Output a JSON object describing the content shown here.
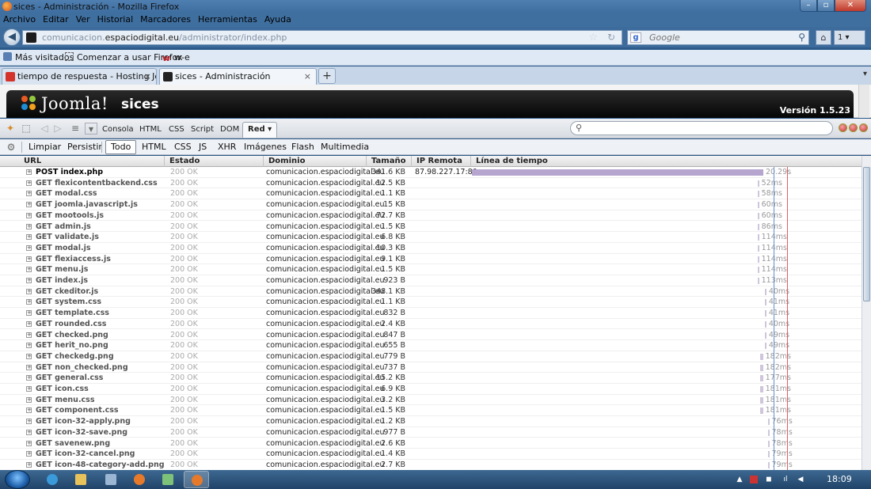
{
  "window": {
    "title": "sices - Administración - Mozilla Firefox"
  },
  "menu": [
    "Archivo",
    "Editar",
    "Ver",
    "Historial",
    "Marcadores",
    "Herramientas",
    "Ayuda"
  ],
  "nav": {
    "url_prefix": "comunicacion.",
    "url_domain": "espaciodigital.eu",
    "url_path": "/administrator/index.php",
    "search_placeholder": "Google",
    "ext_badge": "1"
  },
  "bookmarks": [
    "Más visitados",
    "Comenzar a usar Firefox",
    "w-e"
  ],
  "tabs": [
    {
      "label": "tiempo de respuesta - Hosting Joomla"
    },
    {
      "label": "sices - Administración"
    }
  ],
  "joomla": {
    "brand": "Joomla!",
    "site": "sices",
    "version": "Versión 1.5.23"
  },
  "firebug": {
    "panels": [
      "Consola",
      "HTML",
      "CSS",
      "Script",
      "DOM",
      "Red"
    ],
    "selected_panel": "Red",
    "filters": [
      "Limpiar",
      "Persistir",
      "Todo",
      "HTML",
      "CSS",
      "JS",
      "XHR",
      "Imágenes",
      "Flash",
      "Multimedia"
    ],
    "selected_filter": "Todo"
  },
  "net": {
    "columns": {
      "url": "URL",
      "status": "Estado",
      "domain": "Dominio",
      "size": "Tamaño",
      "ip": "IP Remota",
      "timeline": "Línea de tiempo"
    },
    "rows": [
      {
        "url": "POST index.php",
        "status": "200 OK",
        "domain": "comunicacion.espaciodigital.eu",
        "size": "341.6 KB",
        "ip": "87.98.227.17:80",
        "time": "20.29s",
        "start": 0.0,
        "dur": 1.0
      },
      {
        "url": "GET flexicontentbackend.css",
        "status": "200 OK",
        "domain": "comunicacion.espaciodigital.eu",
        "size": "12.5 KB",
        "ip": "",
        "time": "52ms",
        "start": 0.98,
        "dur": 0.003
      },
      {
        "url": "GET modal.css",
        "status": "200 OK",
        "domain": "comunicacion.espaciodigital.eu",
        "size": "1.1 KB",
        "ip": "",
        "time": "58ms",
        "start": 0.98,
        "dur": 0.003
      },
      {
        "url": "GET joomla.javascript.js",
        "status": "200 OK",
        "domain": "comunicacion.espaciodigital.eu",
        "size": "15 KB",
        "ip": "",
        "time": "60ms",
        "start": 0.98,
        "dur": 0.003
      },
      {
        "url": "GET mootools.js",
        "status": "200 OK",
        "domain": "comunicacion.espaciodigital.eu",
        "size": "72.7 KB",
        "ip": "",
        "time": "60ms",
        "start": 0.98,
        "dur": 0.003
      },
      {
        "url": "GET admin.js",
        "status": "200 OK",
        "domain": "comunicacion.espaciodigital.eu",
        "size": "1.5 KB",
        "ip": "",
        "time": "86ms",
        "start": 0.98,
        "dur": 0.004
      },
      {
        "url": "GET validate.js",
        "status": "200 OK",
        "domain": "comunicacion.espaciodigital.eu",
        "size": "6.8 KB",
        "ip": "",
        "time": "114ms",
        "start": 0.98,
        "dur": 0.005
      },
      {
        "url": "GET modal.js",
        "status": "200 OK",
        "domain": "comunicacion.espaciodigital.eu",
        "size": "10.3 KB",
        "ip": "",
        "time": "114ms",
        "start": 0.98,
        "dur": 0.005
      },
      {
        "url": "GET flexiaccess.js",
        "status": "200 OK",
        "domain": "comunicacion.espaciodigital.eu",
        "size": "9.1 KB",
        "ip": "",
        "time": "114ms",
        "start": 0.98,
        "dur": 0.005
      },
      {
        "url": "GET menu.js",
        "status": "200 OK",
        "domain": "comunicacion.espaciodigital.eu",
        "size": "1.5 KB",
        "ip": "",
        "time": "114ms",
        "start": 0.98,
        "dur": 0.005
      },
      {
        "url": "GET index.js",
        "status": "200 OK",
        "domain": "comunicacion.espaciodigital.eu",
        "size": "923 B",
        "ip": "",
        "time": "113ms",
        "start": 0.98,
        "dur": 0.005
      },
      {
        "url": "GET ckeditor.js",
        "status": "200 OK",
        "domain": "comunicacion.espaciodigital.eu",
        "size": "348.1 KB",
        "ip": "",
        "time": "40ms",
        "start": 1.005,
        "dur": 0.002
      },
      {
        "url": "GET system.css",
        "status": "200 OK",
        "domain": "comunicacion.espaciodigital.eu",
        "size": "1.1 KB",
        "ip": "",
        "time": "41ms",
        "start": 1.005,
        "dur": 0.002
      },
      {
        "url": "GET template.css",
        "status": "200 OK",
        "domain": "comunicacion.espaciodigital.eu",
        "size": "832 B",
        "ip": "",
        "time": "41ms",
        "start": 1.005,
        "dur": 0.002
      },
      {
        "url": "GET rounded.css",
        "status": "200 OK",
        "domain": "comunicacion.espaciodigital.eu",
        "size": "2.4 KB",
        "ip": "",
        "time": "40ms",
        "start": 1.005,
        "dur": 0.002
      },
      {
        "url": "GET checked.png",
        "status": "200 OK",
        "domain": "comunicacion.espaciodigital.eu",
        "size": "847 B",
        "ip": "",
        "time": "49ms",
        "start": 1.005,
        "dur": 0.002
      },
      {
        "url": "GET herit_no.png",
        "status": "200 OK",
        "domain": "comunicacion.espaciodigital.eu",
        "size": "655 B",
        "ip": "",
        "time": "49ms",
        "start": 1.005,
        "dur": 0.002
      },
      {
        "url": "GET checkedg.png",
        "status": "200 OK",
        "domain": "comunicacion.espaciodigital.eu",
        "size": "779 B",
        "ip": "",
        "time": "182ms",
        "start": 0.99,
        "dur": 0.009
      },
      {
        "url": "GET non_checked.png",
        "status": "200 OK",
        "domain": "comunicacion.espaciodigital.eu",
        "size": "737 B",
        "ip": "",
        "time": "182ms",
        "start": 0.99,
        "dur": 0.009
      },
      {
        "url": "GET general.css",
        "status": "200 OK",
        "domain": "comunicacion.espaciodigital.eu",
        "size": "15.2 KB",
        "ip": "",
        "time": "177ms",
        "start": 0.99,
        "dur": 0.009
      },
      {
        "url": "GET icon.css",
        "status": "200 OK",
        "domain": "comunicacion.espaciodigital.eu",
        "size": "6.9 KB",
        "ip": "",
        "time": "181ms",
        "start": 0.99,
        "dur": 0.009
      },
      {
        "url": "GET menu.css",
        "status": "200 OK",
        "domain": "comunicacion.espaciodigital.eu",
        "size": "3.2 KB",
        "ip": "",
        "time": "181ms",
        "start": 0.99,
        "dur": 0.009
      },
      {
        "url": "GET component.css",
        "status": "200 OK",
        "domain": "comunicacion.espaciodigital.eu",
        "size": "1.5 KB",
        "ip": "",
        "time": "181ms",
        "start": 0.99,
        "dur": 0.009
      },
      {
        "url": "GET icon-32-apply.png",
        "status": "200 OK",
        "domain": "comunicacion.espaciodigital.eu",
        "size": "1.2 KB",
        "ip": "",
        "time": "76ms",
        "start": 1.015,
        "dur": 0.003
      },
      {
        "url": "GET icon-32-save.png",
        "status": "200 OK",
        "domain": "comunicacion.espaciodigital.eu",
        "size": "977 B",
        "ip": "",
        "time": "78ms",
        "start": 1.015,
        "dur": 0.003
      },
      {
        "url": "GET savenew.png",
        "status": "200 OK",
        "domain": "comunicacion.espaciodigital.eu",
        "size": "2.6 KB",
        "ip": "",
        "time": "78ms",
        "start": 1.015,
        "dur": 0.003
      },
      {
        "url": "GET icon-32-cancel.png",
        "status": "200 OK",
        "domain": "comunicacion.espaciodigital.eu",
        "size": "1.4 KB",
        "ip": "",
        "time": "79ms",
        "start": 1.015,
        "dur": 0.003
      },
      {
        "url": "GET icon-48-category-add.png",
        "status": "200 OK",
        "domain": "comunicacion.espaciodigital.eu",
        "size": "2.7 KB",
        "ip": "",
        "time": "79ms",
        "start": 1.015,
        "dur": 0.003
      }
    ]
  },
  "taskbar": {
    "clock": "18:09"
  },
  "colors": {
    "timeline_bar": "#b6a5cf",
    "selected_border": "#7c8896",
    "joomla_bar": "#111111"
  }
}
